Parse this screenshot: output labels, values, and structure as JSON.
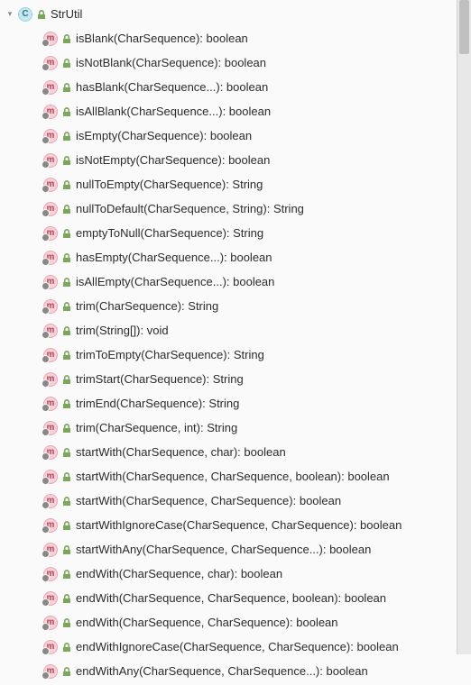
{
  "class": {
    "name": "StrUtil",
    "icon_letter": "C"
  },
  "methods": [
    {
      "icon_letter": "m",
      "has_lock": true,
      "label": "isBlank(CharSequence): boolean"
    },
    {
      "icon_letter": "m",
      "has_lock": true,
      "label": "isNotBlank(CharSequence): boolean"
    },
    {
      "icon_letter": "m",
      "has_lock": true,
      "label": "hasBlank(CharSequence...): boolean"
    },
    {
      "icon_letter": "m",
      "has_lock": true,
      "label": "isAllBlank(CharSequence...): boolean"
    },
    {
      "icon_letter": "m",
      "has_lock": true,
      "label": "isEmpty(CharSequence): boolean"
    },
    {
      "icon_letter": "m",
      "has_lock": true,
      "label": "isNotEmpty(CharSequence): boolean"
    },
    {
      "icon_letter": "m",
      "has_lock": true,
      "label": "nullToEmpty(CharSequence): String"
    },
    {
      "icon_letter": "m",
      "has_lock": true,
      "label": "nullToDefault(CharSequence, String): String"
    },
    {
      "icon_letter": "m",
      "has_lock": true,
      "label": "emptyToNull(CharSequence): String"
    },
    {
      "icon_letter": "m",
      "has_lock": true,
      "label": "hasEmpty(CharSequence...): boolean"
    },
    {
      "icon_letter": "m",
      "has_lock": true,
      "label": "isAllEmpty(CharSequence...): boolean"
    },
    {
      "icon_letter": "m",
      "has_lock": true,
      "label": "trim(CharSequence): String"
    },
    {
      "icon_letter": "m",
      "has_lock": true,
      "label": "trim(String[]): void"
    },
    {
      "icon_letter": "m",
      "has_lock": true,
      "label": "trimToEmpty(CharSequence): String"
    },
    {
      "icon_letter": "m",
      "has_lock": true,
      "label": "trimStart(CharSequence): String"
    },
    {
      "icon_letter": "m",
      "has_lock": true,
      "label": "trimEnd(CharSequence): String"
    },
    {
      "icon_letter": "m",
      "has_lock": true,
      "label": "trim(CharSequence, int): String"
    },
    {
      "icon_letter": "m",
      "has_lock": true,
      "label": "startWith(CharSequence, char): boolean"
    },
    {
      "icon_letter": "m",
      "has_lock": true,
      "label": "startWith(CharSequence, CharSequence, boolean): boolean"
    },
    {
      "icon_letter": "m",
      "has_lock": true,
      "label": "startWith(CharSequence, CharSequence): boolean"
    },
    {
      "icon_letter": "m",
      "has_lock": true,
      "label": "startWithIgnoreCase(CharSequence, CharSequence): boolean"
    },
    {
      "icon_letter": "m",
      "has_lock": true,
      "label": "startWithAny(CharSequence, CharSequence...): boolean"
    },
    {
      "icon_letter": "m",
      "has_lock": true,
      "label": "endWith(CharSequence, char): boolean"
    },
    {
      "icon_letter": "m",
      "has_lock": true,
      "label": "endWith(CharSequence, CharSequence, boolean): boolean"
    },
    {
      "icon_letter": "m",
      "has_lock": true,
      "label": "endWith(CharSequence, CharSequence): boolean"
    },
    {
      "icon_letter": "m",
      "has_lock": true,
      "label": "endWithIgnoreCase(CharSequence, CharSequence): boolean"
    },
    {
      "icon_letter": "m",
      "has_lock": true,
      "label": "endWithAny(CharSequence, CharSequence...): boolean"
    }
  ]
}
